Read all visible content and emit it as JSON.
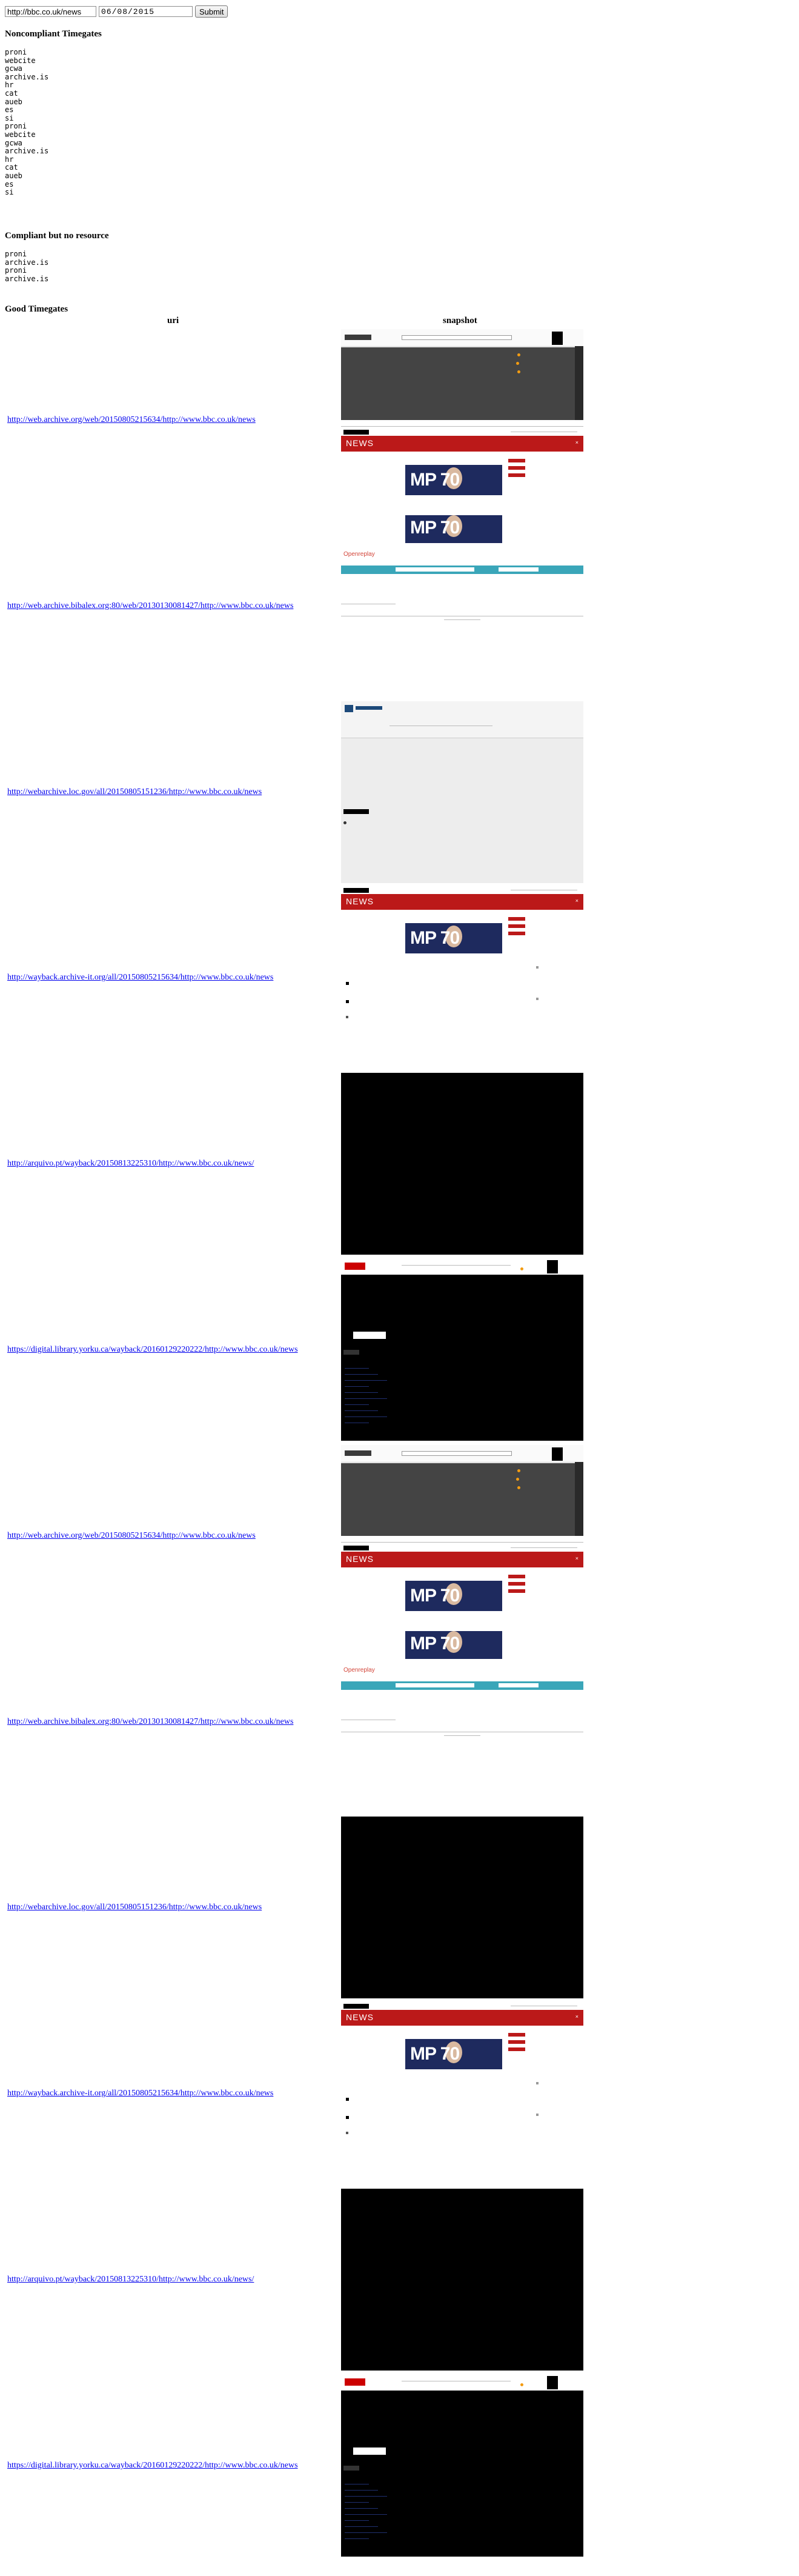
{
  "form": {
    "url_value": "http://bbc.co.uk/news",
    "date_value": "06/08/2015",
    "submit_label": "Submit"
  },
  "noncompliant": {
    "heading": "Noncompliant Timegates",
    "list": "proni\nwebcite\ngcwa\narchive.is\nhr\ncat\naueb\nes\nsi\nproni\nwebcite\ngcwa\narchive.is\nhr\ncat\naueb\nes\nsi"
  },
  "compliant_no_resource": {
    "heading": "Compliant but no resource",
    "list": "proni\narchive.is\nproni\narchive.is"
  },
  "good": {
    "heading": "Good Timegates",
    "col_uri": "uri",
    "col_snapshot": "snapshot",
    "snapshot_news_label": "NEWS",
    "snapshot_hero_text": "MP 70",
    "snapshot_openreplay": "Openreplay",
    "rows": [
      {
        "uri": "http://web.archive.org/web/20150805215634/http://www.bbc.co.uk/news"
      },
      {
        "uri": "http://web.archive.bibalex.org:80/web/20130130081427/http://www.bbc.co.uk/news"
      },
      {
        "uri": "http://webarchive.loc.gov/all/20150805151236/http://www.bbc.co.uk/news"
      },
      {
        "uri": "http://wayback.archive-it.org/all/20150805215634/http://www.bbc.co.uk/news"
      },
      {
        "uri": "http://arquivo.pt/wayback/20150813225310/http://www.bbc.co.uk/news/"
      },
      {
        "uri": "https://digital.library.yorku.ca/wayback/20160129220222/http://www.bbc.co.uk/news"
      },
      {
        "uri": "http://web.archive.org/web/20150805215634/http://www.bbc.co.uk/news"
      },
      {
        "uri": "http://web.archive.bibalex.org:80/web/20130130081427/http://www.bbc.co.uk/news"
      },
      {
        "uri": "http://webarchive.loc.gov/all/20150805151236/http://www.bbc.co.uk/news"
      },
      {
        "uri": "http://wayback.archive-it.org/all/20150805215634/http://www.bbc.co.uk/news"
      },
      {
        "uri": "http://arquivo.pt/wayback/20150813225310/http://www.bbc.co.uk/news/"
      },
      {
        "uri": "https://digital.library.yorku.ca/wayback/20160129220222/http://www.bbc.co.uk/news"
      }
    ]
  }
}
